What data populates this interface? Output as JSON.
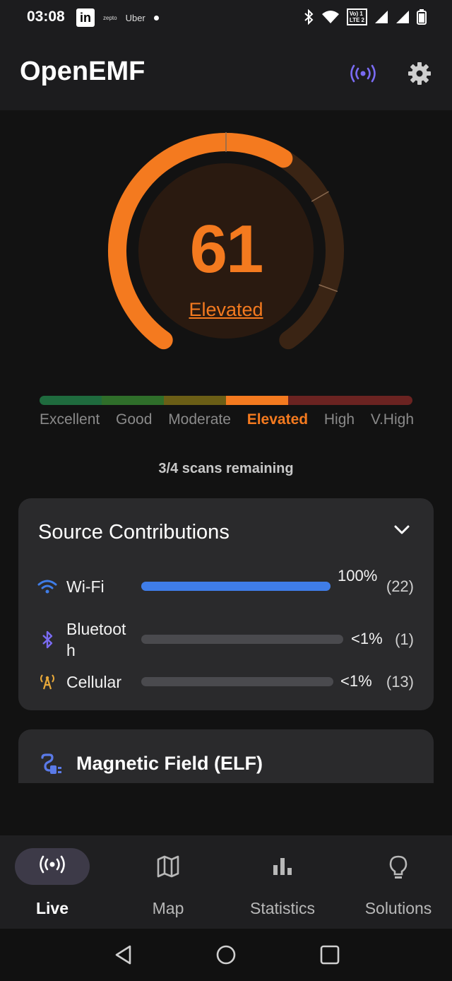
{
  "status_bar": {
    "time": "03:08",
    "linkedin": "in",
    "notif_small": "zepto",
    "uber": "Uber",
    "volte_top": "Vo) 1",
    "volte_bottom": "LTE 2"
  },
  "header": {
    "title": "OpenEMF"
  },
  "gauge": {
    "value": "61",
    "status": "Elevated",
    "fill_fraction": 0.61,
    "color": "#f47a1f"
  },
  "scale": {
    "labels": [
      "Excellent",
      "Good",
      "Moderate",
      "Elevated",
      "High",
      "V.High"
    ],
    "active_index": 3,
    "colors": [
      "#1f6b3e",
      "#2f6e2a",
      "#6b5e16",
      "#f47a1f",
      "#6b2321",
      "#6b2321"
    ]
  },
  "scans": {
    "text": "3/4 scans remaining"
  },
  "sources": {
    "title": "Source Contributions",
    "items": [
      {
        "label": "Wi-Fi",
        "percent": "100%",
        "count": "(22)",
        "fill": 1.0,
        "icon": "wifi-icon"
      },
      {
        "label": "Bluetooth",
        "percent": "<1%",
        "count": "(1)",
        "fill": 0.0,
        "icon": "bluetooth-icon"
      },
      {
        "label": "Cellular",
        "percent": "<1%",
        "count": "(13)",
        "fill": 0.0,
        "icon": "cell-tower-icon"
      }
    ]
  },
  "magnetic": {
    "title": "Magnetic Field (ELF)"
  },
  "nav": {
    "items": [
      {
        "label": "Live",
        "icon": "broadcast-icon"
      },
      {
        "label": "Map",
        "icon": "map-icon"
      },
      {
        "label": "Statistics",
        "icon": "bar-chart-icon"
      },
      {
        "label": "Solutions",
        "icon": "lightbulb-icon"
      }
    ]
  },
  "colors": {
    "accent": "#f47a1f",
    "wifi_bar": "#3f7de8",
    "live_icon": "#7a6bf2"
  }
}
